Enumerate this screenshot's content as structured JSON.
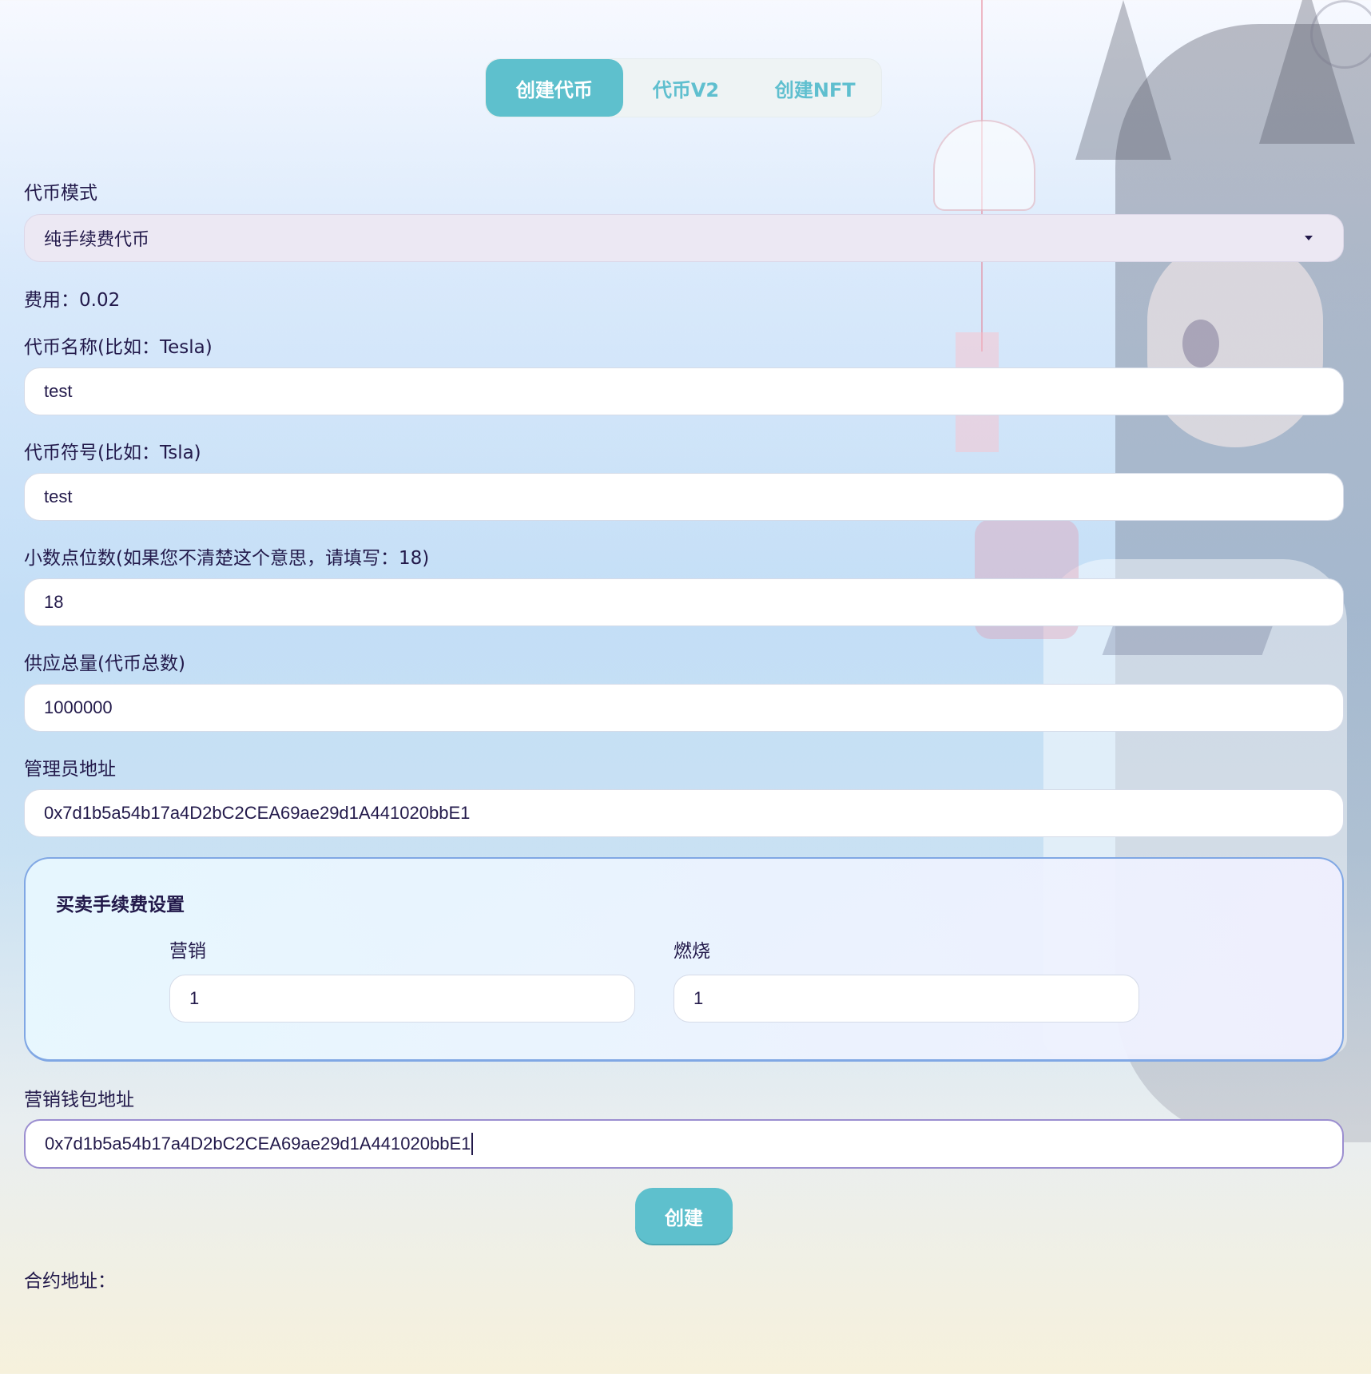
{
  "tabs": [
    {
      "label": "创建代币",
      "active": true
    },
    {
      "label": "代币V2",
      "active": false
    },
    {
      "label": "创建NFT",
      "active": false
    }
  ],
  "form": {
    "token_mode": {
      "label": "代币模式",
      "value": "纯手续费代币"
    },
    "fee": {
      "label": "费用：",
      "value": "0.02"
    },
    "token_name": {
      "label": "代币名称(比如：Tesla)",
      "value": "test"
    },
    "token_symbol": {
      "label": "代币符号(比如：Tsla)",
      "value": "test"
    },
    "decimals": {
      "label": "小数点位数(如果您不清楚这个意思，请填写：18)",
      "value": "18"
    },
    "total_supply": {
      "label": "供应总量(代币总数)",
      "value": "1000000"
    },
    "admin_address": {
      "label": "管理员地址",
      "value": "0x7d1b5a54b17a4D2bC2CEA69ae29d1A441020bbE1"
    },
    "fee_settings": {
      "title": "买卖手续费设置",
      "marketing": {
        "label": "营销",
        "value": "1"
      },
      "burn": {
        "label": "燃烧",
        "value": "1"
      }
    },
    "marketing_wallet": {
      "label": "营销钱包地址",
      "value": "0x7d1b5a54b17a4D2bC2CEA69ae29d1A441020bbE1"
    },
    "create_button": "创建",
    "contract_address": {
      "label": "合约地址："
    }
  },
  "colors": {
    "accent": "#5ec0cd",
    "text": "#22194a",
    "fee_box_border": "#80a7e4",
    "focus_border": "#9b8ed0"
  }
}
